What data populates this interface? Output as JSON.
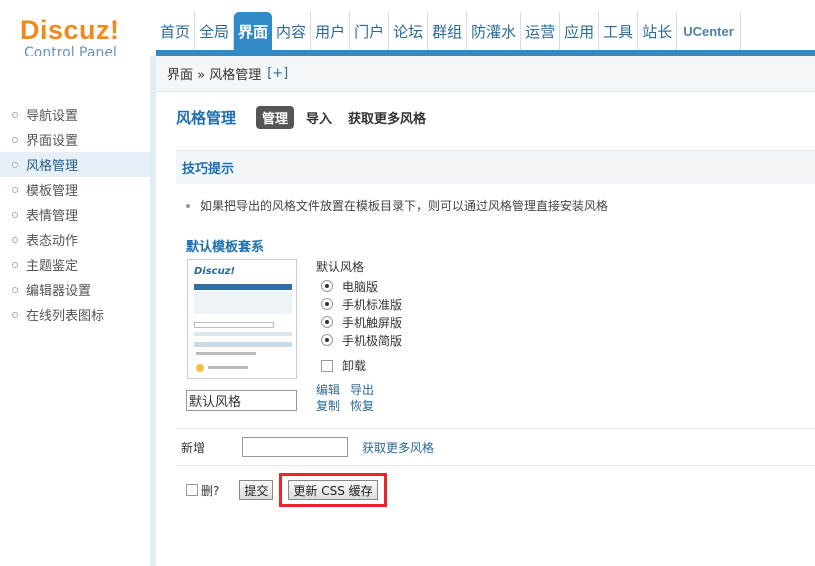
{
  "header": {
    "logo_brand": "Discuz!",
    "logo_sub": "Control Panel",
    "nav": [
      "首页",
      "全局",
      "界面",
      "内容",
      "用户",
      "门户",
      "论坛",
      "群组",
      "防灌水",
      "运营",
      "应用",
      "工具",
      "站长",
      "UCenter"
    ],
    "active_nav": "界面"
  },
  "sidebar": {
    "items": [
      {
        "label": "导航设置"
      },
      {
        "label": "界面设置"
      },
      {
        "label": "风格管理",
        "active": true
      },
      {
        "label": "模板管理"
      },
      {
        "label": "表情管理"
      },
      {
        "label": "表态动作"
      },
      {
        "label": "主题鉴定"
      },
      {
        "label": "编辑器设置"
      },
      {
        "label": "在线列表图标"
      }
    ]
  },
  "breadcrumb": {
    "path": "界面 » 风格管理",
    "add": "[+]"
  },
  "page": {
    "title": "风格管理",
    "tabs": [
      "管理",
      "导入",
      "获取更多风格"
    ],
    "active_tab": "管理"
  },
  "tips": {
    "heading": "技巧提示",
    "text": "如果把导出的风格文件放置在模板目录下，则可以通过风格管理直接安装风格"
  },
  "template": {
    "title": "默认模板套系",
    "name_value": "默认风格",
    "style_label": "默认风格",
    "radios": [
      {
        "label": "电脑版",
        "checked": true
      },
      {
        "label": "手机标准版",
        "checked": true
      },
      {
        "label": "手机触屏版",
        "checked": true
      },
      {
        "label": "手机极简版",
        "checked": true
      }
    ],
    "uninstall_label": "卸载",
    "actions": {
      "edit": "编辑",
      "export": "导出",
      "copy": "复制",
      "restore": "恢复"
    }
  },
  "new_row": {
    "label": "新增",
    "input_value": "",
    "more_link": "获取更多风格"
  },
  "bottom": {
    "delete_label": "删?",
    "submit": "提交",
    "update_css": "更新 CSS 缓存"
  }
}
